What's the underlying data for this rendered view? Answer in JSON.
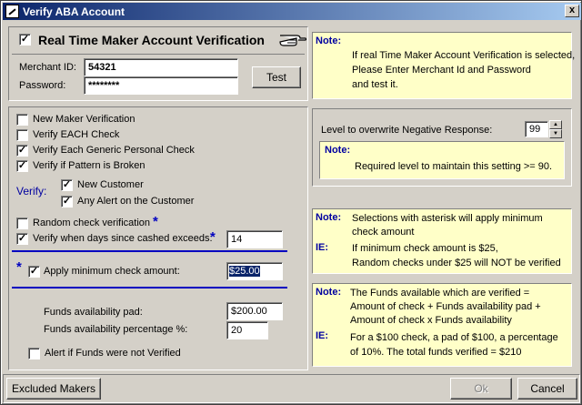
{
  "window": {
    "title": "Verify ABA Account",
    "close_glyph": "x"
  },
  "header": {
    "realtime_label": "Real Time Maker Account Verification",
    "realtime_checked": true
  },
  "merchant": {
    "merchant_id_label": "Merchant ID:",
    "merchant_id_value": "54321",
    "password_label": "Password:",
    "password_value": "********",
    "test_button": "Test"
  },
  "note_top": {
    "title": "Note:",
    "lines": [
      "If real Time Maker Account Verification is selected,",
      "Please Enter Merchant Id and Password",
      "and test it."
    ]
  },
  "options": {
    "new_maker": {
      "label": "New Maker Verification",
      "checked": false
    },
    "verify_each_check": {
      "label": "Verify EACH Check",
      "checked": false
    },
    "verify_generic": {
      "label": "Verify Each Generic Personal Check",
      "checked": true
    },
    "verify_pattern": {
      "label": "Verify if Pattern is Broken",
      "checked": true
    },
    "verify_label": "Verify:",
    "new_customer": {
      "label": "New Customer",
      "checked": true
    },
    "any_alert": {
      "label": "Any Alert on the Customer",
      "checked": true
    },
    "random_check": {
      "label": "Random check verification",
      "checked": false
    },
    "days_since_cashed": {
      "label": "Verify when days since cashed exceeds:",
      "checked": true,
      "value": "14"
    },
    "apply_minimum": {
      "label": "Apply minimum check amount:",
      "checked": true,
      "value": "$25.00"
    },
    "funds_pad": {
      "label": "Funds availability pad:",
      "value": "$200.00"
    },
    "funds_pct": {
      "label": "Funds availability percentage %:",
      "value": "20"
    },
    "alert_funds": {
      "label": "Alert if Funds were not Verified",
      "checked": false
    },
    "star": "*"
  },
  "level": {
    "label": "Level to overwrite Negative Response:",
    "value": "99",
    "note_title": "Note:",
    "note_text": "Required  level to maintain this setting >= 90."
  },
  "note_asterisk": {
    "title": "Note:",
    "text1": "Selections with asterisk will apply minimum",
    "text2": "check amount",
    "ie_title": "IE:",
    "ie1": "If minimum check amount is $25,",
    "ie2": "Random checks under $25 will NOT be verified"
  },
  "note_funds": {
    "title": "Note:",
    "t1": "The Funds available which are  verified =",
    "t2": "Amount of check + Funds availability pad +",
    "t3": "Amount of check x Funds availability",
    "ie_title": "IE:",
    "ie1": "For a $100 check, a pad of $100, a percentage",
    "ie2": "of 10%. The total funds verified = $210"
  },
  "footer": {
    "excluded_makers": "Excluded Makers",
    "ok": "Ok",
    "cancel": "Cancel"
  }
}
